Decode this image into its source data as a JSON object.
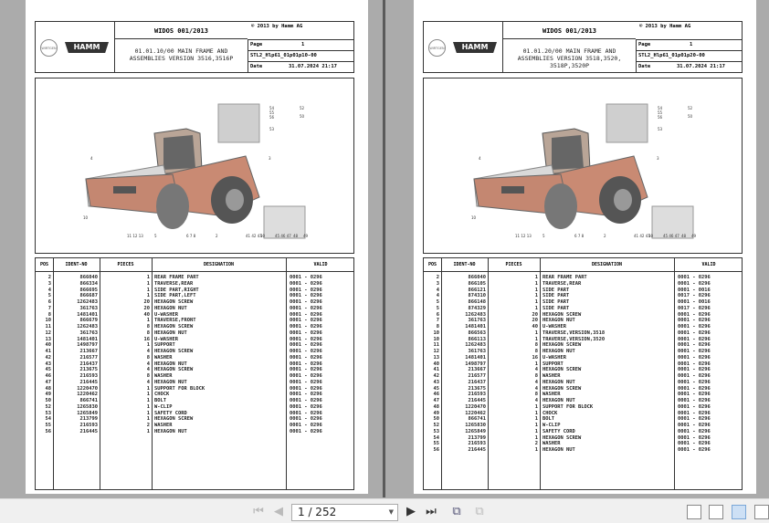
{
  "viewer": {
    "page_field": "1 / 252",
    "buttons": {
      "first": "first-page",
      "prev": "previous-page",
      "next": "next-page",
      "last": "last-page"
    }
  },
  "pages": [
    {
      "doc": "WIDOS 001/2013",
      "copyright": "© 2013 by Hamm AG",
      "logo_brand": "HAMM",
      "logo_group": "WIRTGEN GROUP",
      "desc_lines": [
        "01.01.10/00 MAIN FRAME AND",
        "ASSEMBLIES  VERSION 3516,3516P"
      ],
      "page_label": "Page",
      "page_no": "1",
      "code": "STL2_Hlp61_01p01p10-00",
      "date_label": "Date",
      "date": "31.07.2024  21:17",
      "callouts": [
        "4",
        "10",
        "11 12 13",
        "5",
        "6 7 8",
        "2",
        "3",
        "41 42 43",
        "50",
        "45 46 47",
        "48",
        "49",
        "54",
        "55",
        "56",
        "53",
        "52",
        "50"
      ],
      "headers": [
        "POS",
        "IDENT-NO",
        "PIECES",
        "DESIGNATION",
        "VALID"
      ],
      "rows": [
        [
          "2",
          "866040",
          "1",
          "REAR FRAME PART",
          "0001 - 0296"
        ],
        [
          "3",
          "866334",
          "1",
          "TRAVERSE,REAR",
          "0001 - 0296"
        ],
        [
          "4",
          "866695",
          "1",
          "SIDE PART,RIGHT",
          "0001 - 0296"
        ],
        [
          "5",
          "866687",
          "1",
          "SIDE PART,LEFT",
          "0001 - 0296"
        ],
        [
          "6",
          "1262483",
          "20",
          "HEXAGON SCREW",
          "0001 - 0296"
        ],
        [
          "7",
          "361763",
          "20",
          "HEXAGON NUT",
          "0001 - 0296"
        ],
        [
          "8",
          "1481401",
          "40",
          "U-WASHER",
          "0001 - 0296"
        ],
        [
          "10",
          "866679",
          "1",
          "TRAVERSE,FRONT",
          "0001 - 0296"
        ],
        [
          "11",
          "1262483",
          "8",
          "HEXAGON SCREW",
          "0001 - 0296"
        ],
        [
          "12",
          "361763",
          "8",
          "HEXAGON NUT",
          "0001 - 0296"
        ],
        [
          "13",
          "1481401",
          "16",
          "U-WASHER",
          "0001 - 0296"
        ],
        [
          "40",
          "1498797",
          "1",
          "SUPPORT",
          "0001 - 0296"
        ],
        [
          "41",
          "213667",
          "4",
          "HEXAGON SCREW",
          "0001 - 0296"
        ],
        [
          "42",
          "216577",
          "8",
          "WASHER",
          "0001 - 0296"
        ],
        [
          "43",
          "216437",
          "4",
          "HEXAGON NUT",
          "0001 - 0296"
        ],
        [
          "45",
          "213675",
          "4",
          "HEXAGON SCREW",
          "0001 - 0296"
        ],
        [
          "46",
          "216593",
          "8",
          "WASHER",
          "0001 - 0296"
        ],
        [
          "47",
          "216445",
          "4",
          "HEXAGON NUT",
          "0001 - 0296"
        ],
        [
          "48",
          "1220470",
          "1",
          "SUPPORT FOR BLOCK",
          "0001 - 0296"
        ],
        [
          "49",
          "1220462",
          "1",
          "CHOCK",
          "0001 - 0296"
        ],
        [
          "50",
          "866741",
          "1",
          "BOLT",
          "0001 - 0296"
        ],
        [
          "52",
          "1265830",
          "1",
          "W-CLIP",
          "0001 - 0296"
        ],
        [
          "53",
          "1265849",
          "1",
          "SAFETY CORD",
          "0001 - 0296"
        ],
        [
          "54",
          "213799",
          "1",
          "HEXAGON SCREW",
          "0001 - 0296"
        ],
        [
          "55",
          "216593",
          "2",
          "WASHER",
          "0001 - 0296"
        ],
        [
          "56",
          "216445",
          "1",
          "HEXAGON NUT",
          "0001 - 0296"
        ]
      ]
    },
    {
      "doc": "WIDOS 001/2013",
      "copyright": "© 2013 by Hamm AG",
      "logo_brand": "HAMM",
      "logo_group": "WIRTGEN GROUP",
      "desc_lines": [
        "01.01.20/00 MAIN FRAME AND",
        "ASSEMBLIES  VERSION 3518,3520,",
        "3518P,3520P"
      ],
      "page_label": "Page",
      "page_no": "1",
      "code": "STL2_Hlp61_01p01p20-00",
      "date_label": "Date",
      "date": "31.07.2024  21:17",
      "callouts": [
        "4",
        "10",
        "11 12 13",
        "5",
        "6 7 8",
        "2",
        "3",
        "41 42 43",
        "50",
        "45 46 47",
        "48",
        "49",
        "54",
        "55",
        "56",
        "53",
        "52",
        "50"
      ],
      "headers": [
        "POS",
        "IDENT-NO",
        "PIECES",
        "DESIGNATION",
        "VALID"
      ],
      "rows": [
        [
          "2",
          "866040",
          "1",
          "REAR FRAME PART",
          "0001 - 0296"
        ],
        [
          "3",
          "866105",
          "1",
          "TRAVERSE,REAR",
          "0001 - 0296"
        ],
        [
          "4",
          "866121",
          "1",
          "SIDE PART",
          "0001 - 0016"
        ],
        [
          "4",
          "874310",
          "1",
          "SIDE PART",
          "0017 - 0296"
        ],
        [
          "5",
          "866148",
          "1",
          "SIDE PART",
          "0001 - 0016"
        ],
        [
          "5",
          "874329",
          "1",
          "SIDE PART",
          "0017 - 0296"
        ],
        [
          "6",
          "1262483",
          "20",
          "HEXAGON SCREW",
          "0001 - 0296"
        ],
        [
          "7",
          "361763",
          "20",
          "HEXAGON NUT",
          "0001 - 0296"
        ],
        [
          "8",
          "1481401",
          "40",
          "U-WASHER",
          "0001 - 0296"
        ],
        [
          "10",
          "866563",
          "1",
          "TRAVERSE,VERSION,3518",
          "0001 - 0296"
        ],
        [
          "10",
          "866113",
          "1",
          "TRAVERSE,VERSION,3520",
          "0001 - 0296"
        ],
        [
          "11",
          "1262483",
          "8",
          "HEXAGON SCREW",
          "0001 - 0296"
        ],
        [
          "12",
          "361763",
          "8",
          "HEXAGON NUT",
          "0001 - 0296"
        ],
        [
          "13",
          "1481401",
          "16",
          "U-WASHER",
          "0001 - 0296"
        ],
        [
          "40",
          "1498797",
          "1",
          "SUPPORT",
          "0001 - 0296"
        ],
        [
          "41",
          "213667",
          "4",
          "HEXAGON SCREW",
          "0001 - 0296"
        ],
        [
          "42",
          "216577",
          "8",
          "WASHER",
          "0001 - 0296"
        ],
        [
          "43",
          "216437",
          "4",
          "HEXAGON NUT",
          "0001 - 0296"
        ],
        [
          "45",
          "213675",
          "4",
          "HEXAGON SCREW",
          "0001 - 0296"
        ],
        [
          "46",
          "216593",
          "8",
          "WASHER",
          "0001 - 0296"
        ],
        [
          "47",
          "216445",
          "4",
          "HEXAGON NUT",
          "0001 - 0296"
        ],
        [
          "48",
          "1220470",
          "1",
          "SUPPORT FOR BLOCK",
          "0001 - 0296"
        ],
        [
          "49",
          "1220462",
          "1",
          "CHOCK",
          "0001 - 0296"
        ],
        [
          "50",
          "866741",
          "1",
          "BOLT",
          "0001 - 0296"
        ],
        [
          "52",
          "1265830",
          "1",
          "W-CLIP",
          "0001 - 0296"
        ],
        [
          "53",
          "1265849",
          "1",
          "SAFETY CORD",
          "0001 - 0296"
        ],
        [
          "54",
          "213799",
          "1",
          "HEXAGON SCREW",
          "0001 - 0296"
        ],
        [
          "55",
          "216593",
          "2",
          "WASHER",
          "0001 - 0296"
        ],
        [
          "56",
          "216445",
          "1",
          "HEXAGON NUT",
          "0001 - 0296"
        ]
      ]
    }
  ]
}
